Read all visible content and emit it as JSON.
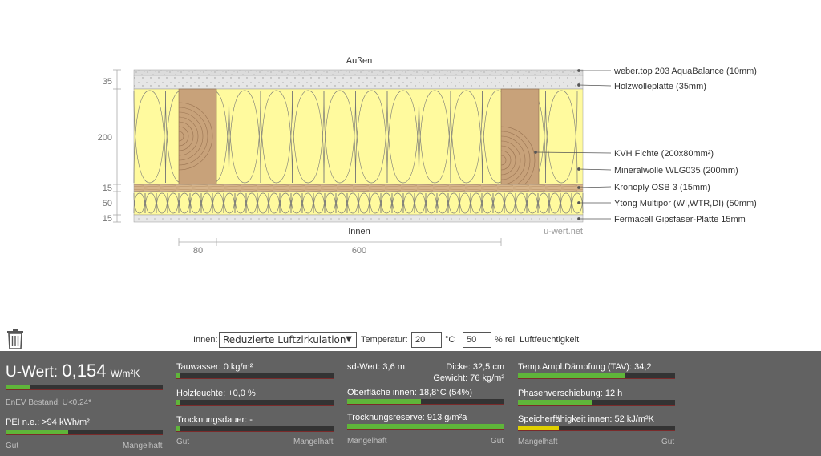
{
  "diagram": {
    "outside_label": "Außen",
    "inside_label": "Innen",
    "watermark": "u-wert.net",
    "layer_dims": [
      "35",
      "200",
      "15",
      "50",
      "15"
    ],
    "bottom_dims": [
      "80",
      "600"
    ],
    "layer_labels": [
      "weber.top 203 AquaBalance (10mm)",
      "Holzwolleplatte (35mm)",
      "KVH Fichte (200x80mm²)",
      "Mineralwolle WLG035 (200mm)",
      "Kronoply OSB 3 (15mm)",
      "Ytong Multipor (WI,WTR,DI) (50mm)",
      "Fermacell Gipsfaser-Platte 15mm"
    ],
    "colors": {
      "insulation": "#fffa9e",
      "wood": "#c8a27a",
      "concrete": "#e0e0e0"
    }
  },
  "controls": {
    "innen_label": "Innen:",
    "air_select": "Reduzierte Luftzirkulation",
    "temp_label": "Temperatur:",
    "temp_value": "20",
    "temp_unit": "°C",
    "humidity_value": "50",
    "humidity_label": "% rel. Luftfeuchtigkeit",
    "trash_icon": "trash-icon"
  },
  "results": {
    "u_label": "U-Wert:",
    "u_value": "0,154",
    "u_unit": "W/m²K",
    "u_fraction": 0.16,
    "enev": "EnEV Bestand: U<0.24*",
    "pei": "PEI n.e.: >94 kWh/m²",
    "pei_fraction": 0.4,
    "col1_left": "Gut",
    "col1_right": "Mangelhaft",
    "tauwasser": "Tauwasser: 0 kg/m²",
    "tauwasser_fraction": 0.01,
    "holzfeuchte": "Holzfeuchte: +0,0 %",
    "holzfeuchte_fraction": 0.01,
    "trocknungsdauer": "Trocknungsdauer: -",
    "trocknungsdauer_fraction": 0.01,
    "col2_left": "Gut",
    "col2_right": "Mangelhaft",
    "sd": "sd-Wert: 3,6 m",
    "dicke": "Dicke: 32,5 cm",
    "gewicht": "Gewicht: 76 kg/m²",
    "oberflaeche": "Oberfläche innen: 18,8°C (54%)",
    "oberflaeche_fraction": 0.47,
    "trocknungsreserve": "Trocknungsreserve: 913 g/m²a",
    "trocknungsreserve_fraction": 1.0,
    "col3_left": "Mangelhaft",
    "col3_right": "Gut",
    "tav": "Temp.Ampl.Dämpfung (TAV): 34,2",
    "tav_fraction": 0.68,
    "phase": "Phasenverschiebung: 12 h",
    "phase_fraction": 0.47,
    "speicher": "Speicherfähigkeit innen: 52 kJ/m²K",
    "speicher_fraction": 0.26,
    "col4_left": "Mangelhaft",
    "col4_right": "Gut"
  }
}
